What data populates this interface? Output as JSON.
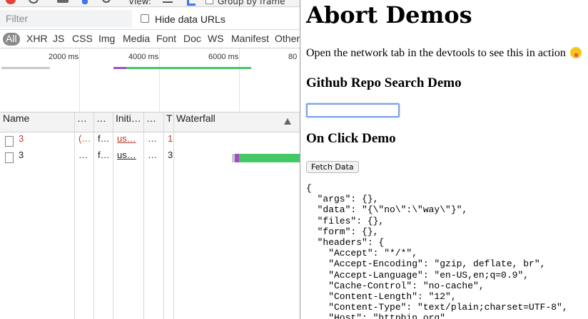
{
  "devtools": {
    "toolbar": {
      "view_label": "View:",
      "group_label": "Group by frame"
    },
    "filter": {
      "placeholder": "Filter",
      "hide_data_urls_label": "Hide data URLs"
    },
    "types": [
      "All",
      "XHR",
      "JS",
      "CSS",
      "Img",
      "Media",
      "Font",
      "Doc",
      "WS",
      "Manifest",
      "Other"
    ],
    "overview": {
      "ticks": [
        "2000 ms",
        "4000 ms",
        "6000 ms",
        "80"
      ]
    },
    "columns": {
      "name": "Name",
      "c2": "…",
      "c3": "…",
      "initiator": "Initi…",
      "c5": "…",
      "c6": "T",
      "waterfall": "Waterfall"
    },
    "rows": [
      {
        "name": "3",
        "c2": "(…",
        "c3": "f…",
        "initiator": "us…",
        "c5": "…",
        "c6": "1",
        "error": true
      },
      {
        "name": "3",
        "c2": "…",
        "c3": "f…",
        "initiator": "us…",
        "c5": "…",
        "c6": "3",
        "error": false
      }
    ],
    "colors": {
      "waiting": "#a64ac9",
      "download": "#44c767",
      "record": "#e2443c"
    }
  },
  "page": {
    "title": "Abort Demos",
    "intro": "Open the network tab in the devtools to see this in action",
    "search_heading": "Github Repo Search Demo",
    "click_heading": "On Click Demo",
    "fetch_button": "Fetch Data",
    "json_output": "{\n  \"args\": {},\n  \"data\": \"{\\\"no\\\":\\\"way\\\"}\",\n  \"files\": {},\n  \"form\": {},\n  \"headers\": {\n    \"Accept\": \"*/*\",\n    \"Accept-Encoding\": \"gzip, deflate, br\",\n    \"Accept-Language\": \"en-US,en;q=0.9\",\n    \"Cache-Control\": \"no-cache\",\n    \"Content-Length\": \"12\",\n    \"Content-Type\": \"text/plain;charset=UTF-8\",\n    \"Host\": \"httpbin.org\","
  }
}
